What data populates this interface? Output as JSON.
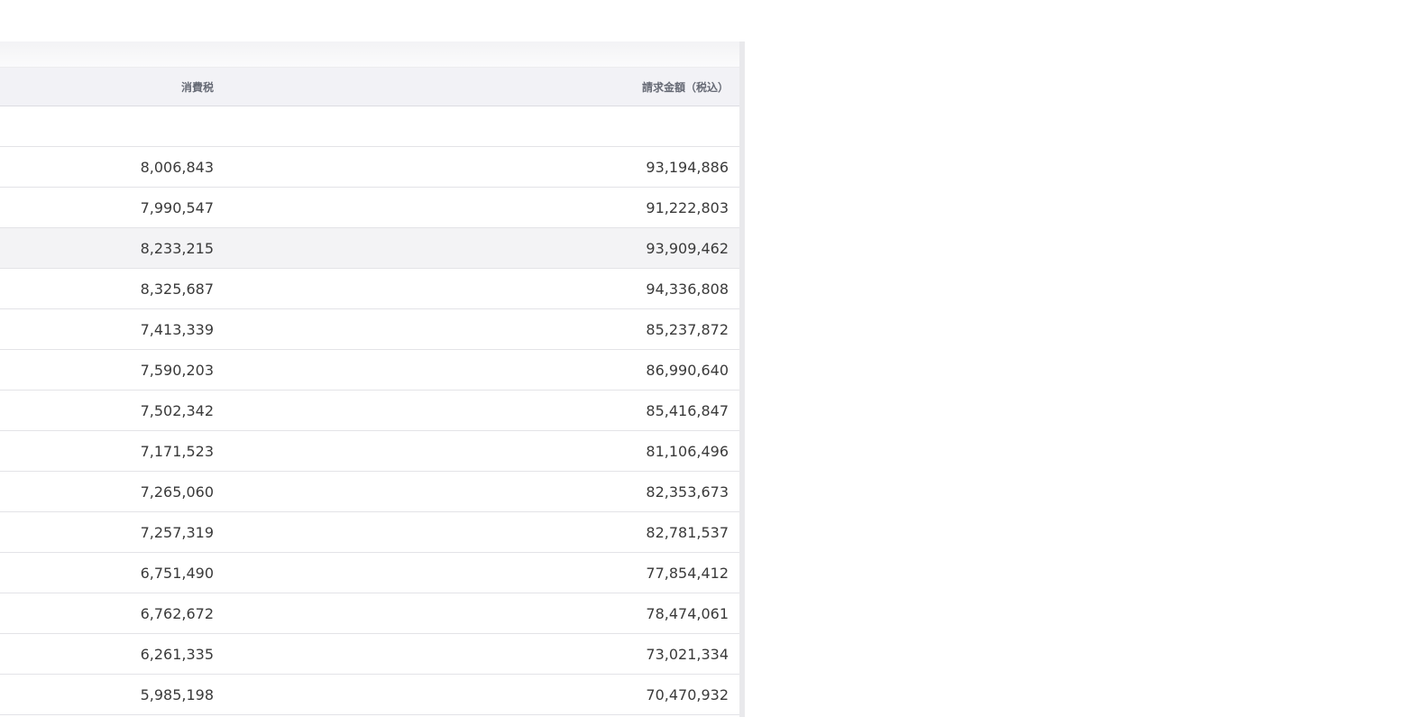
{
  "table": {
    "headers": {
      "tax": "消費税",
      "amount": "請求金額（税込）"
    },
    "rows": [
      {
        "tax": "",
        "amount": ""
      },
      {
        "tax": "8,006,843",
        "amount": "93,194,886"
      },
      {
        "tax": "7,990,547",
        "amount": "91,222,803"
      },
      {
        "tax": "8,233,215",
        "amount": "93,909,462"
      },
      {
        "tax": "8,325,687",
        "amount": "94,336,808"
      },
      {
        "tax": "7,413,339",
        "amount": "85,237,872"
      },
      {
        "tax": "7,590,203",
        "amount": "86,990,640"
      },
      {
        "tax": "7,502,342",
        "amount": "85,416,847"
      },
      {
        "tax": "7,171,523",
        "amount": "81,106,496"
      },
      {
        "tax": "7,265,060",
        "amount": "82,353,673"
      },
      {
        "tax": "7,257,319",
        "amount": "82,781,537"
      },
      {
        "tax": "6,751,490",
        "amount": "77,854,412"
      },
      {
        "tax": "6,762,672",
        "amount": "78,474,061"
      },
      {
        "tax": "6,261,335",
        "amount": "73,021,334"
      },
      {
        "tax": "5,985,198",
        "amount": "70,470,932"
      }
    ]
  }
}
